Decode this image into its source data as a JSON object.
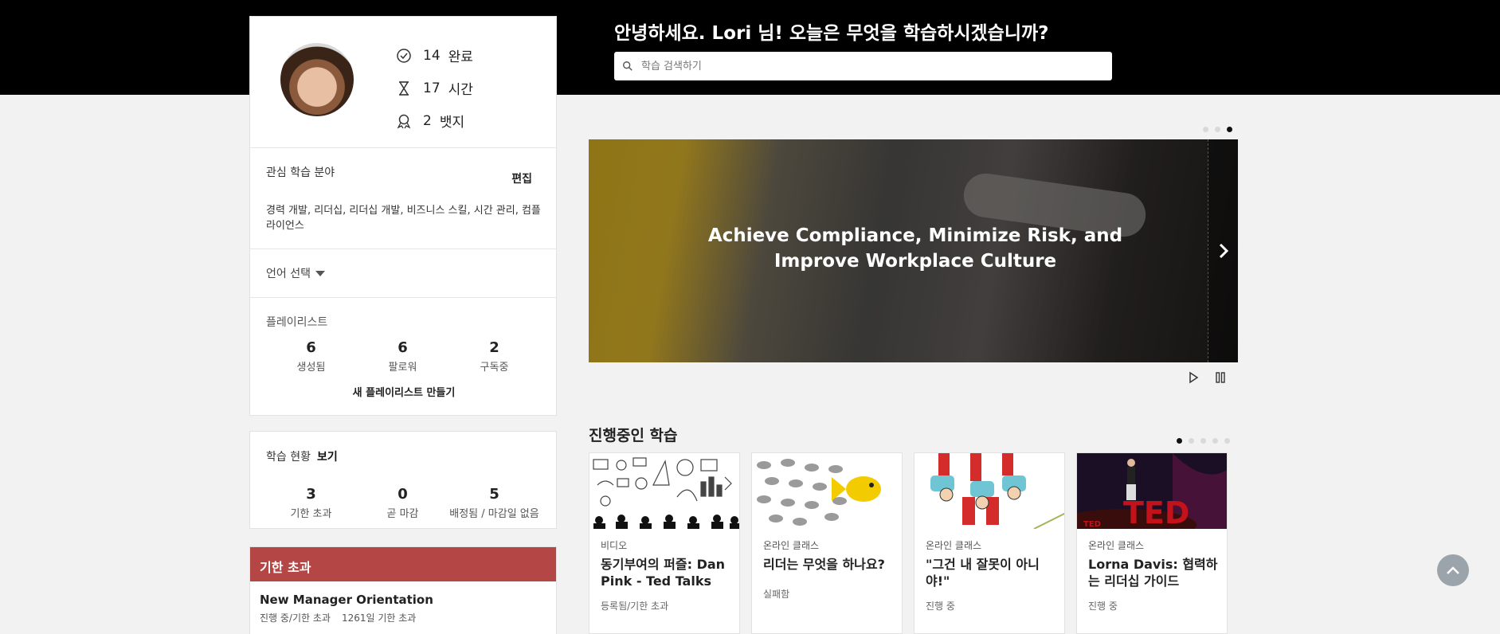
{
  "header": {
    "greeting": "안녕하세요. Lori 님! 오늘은 무엇을 학습하시겠습니까?",
    "search_placeholder": "학습 검색하기"
  },
  "profile": {
    "stats": [
      {
        "value": "14",
        "label": "완료",
        "icon": "check-circle-icon"
      },
      {
        "value": "17",
        "label": "시간",
        "icon": "hourglass-icon"
      },
      {
        "value": "2",
        "label": "뱃지",
        "icon": "badge-icon"
      }
    ]
  },
  "interests": {
    "title": "관심 학습 분야",
    "edit_label": "편집",
    "text": "경력 개발, 리더십, 리더십 개발, 비즈니스 스킬, 시간 관리, 컴플라이언스"
  },
  "language": {
    "label": "언어 선택"
  },
  "playlists": {
    "title": "플레이리스트",
    "stats": [
      {
        "value": "6",
        "label": "생성됨"
      },
      {
        "value": "6",
        "label": "팔로워"
      },
      {
        "value": "2",
        "label": "구독중"
      }
    ],
    "create_label": "새 플레이리스트 만들기"
  },
  "learning_status": {
    "title": "학습 현황",
    "view_label": "보기",
    "stats": [
      {
        "value": "3",
        "label": "기한 초과"
      },
      {
        "value": "0",
        "label": "곧 마감"
      },
      {
        "value": "5",
        "label": "배정됨 / 마감일 없음"
      }
    ]
  },
  "overdue": {
    "heading": "기한 초과",
    "header_color": "#b54646",
    "items": [
      {
        "title": "New Manager Orientation",
        "status": "진행 중/기한 초과",
        "days": "1261일 기한 초과"
      }
    ]
  },
  "banner": {
    "title": "Achieve Compliance, Minimize Risk, and Improve Workplace Culture",
    "active_dot": 2,
    "dot_count": 3
  },
  "in_progress": {
    "title": "진행중인 학습",
    "dot_count": 5,
    "active_dot": 0,
    "courses": [
      {
        "type": "비디오",
        "title": "동기부여의 퍼즐: Dan Pink - Ted Talks",
        "status": "등록됨/기한 초과"
      },
      {
        "type": "온라인 클래스",
        "title": "리더는 무엇을 하나요?",
        "status": "실패함"
      },
      {
        "type": "온라인 클래스",
        "title": "\"그건 내 잘못이 아니야!\"",
        "status": "진행 중"
      },
      {
        "type": "온라인 클래스",
        "title": "Lorna Davis: 협력하는 리더십 가이드",
        "status": "진행 중",
        "thumb_text": "TED"
      }
    ]
  }
}
